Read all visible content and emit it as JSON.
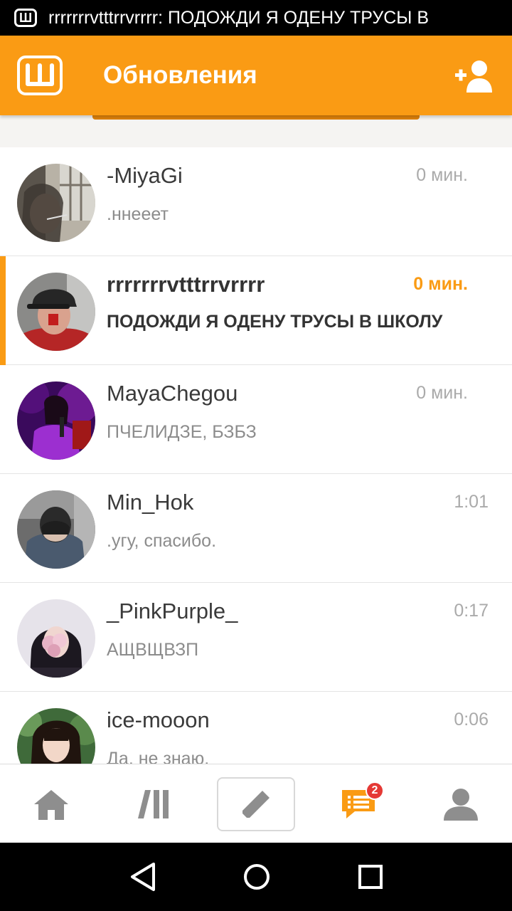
{
  "status_bar": {
    "notification_text": "rrrrrrrvtttrrvrrrr: ПОДОЖДИ Я ОДЕНУ ТРУСЫ В"
  },
  "app_bar": {
    "title": "Обновления"
  },
  "conversations": [
    {
      "name": "-MiyaGi",
      "message": ".ннееет",
      "time": "0 мин.",
      "unread": false
    },
    {
      "name": "rrrrrrrvtttrrvrrrr",
      "message": "ПОДОЖДИ Я ОДЕНУ ТРУСЫ В ШКОЛУ",
      "time": "0 мин.",
      "unread": true
    },
    {
      "name": "MayaChegou",
      "message": "ПЧЕЛИДЗЕ, БЗБЗ",
      "time": "0 мин.",
      "unread": false
    },
    {
      "name": "Min_Hok",
      "message": ".угу, спасибо.",
      "time": "1:01",
      "unread": false
    },
    {
      "name": "_PinkPurple_",
      "message": "АЩВЩВЗП",
      "time": "0:17",
      "unread": false
    },
    {
      "name": "ice-mooon",
      "message": "Да, не знаю.",
      "time": "0:06",
      "unread": false
    }
  ],
  "bottom_nav": {
    "messages_badge": "2"
  },
  "colors": {
    "accent": "#fa9b14",
    "unread_time": "#fa9b14",
    "badge": "#e53935"
  }
}
